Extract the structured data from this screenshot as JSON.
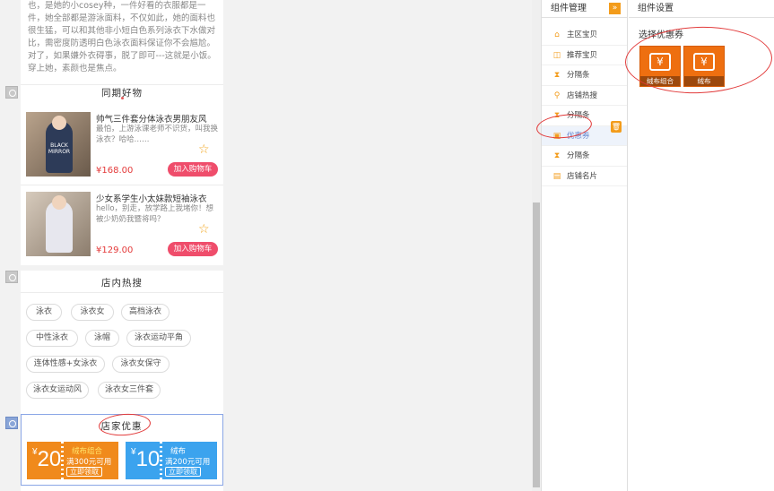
{
  "intro": {
    "text": "也，是她的小cosey种，一件好看的衣服都是一件，她全部都是游泳面料，不仅如此，她的面料也很生猛，可以和其他非小短白色系列泳衣下水做对比，需密度防透明白色泳衣面料保证你不会尴尬。对了，如果嫌外衣碍事，脱了即可---这就是小饭。穿上她，素颜也是焦点。",
    "quote": "\""
  },
  "similar": {
    "title": "同期好物",
    "products": [
      {
        "name": "帅气三件套分体泳衣男朋友风",
        "desc": "最怕，上游泳课老师不识货，叫我换泳衣？哈哈……",
        "price": "¥168.00",
        "cart": "加入购物车",
        "shirt": "BLACK MIRROR"
      },
      {
        "name": "少女系学生小太妹款短袖泳衣",
        "desc": "hello，别走，放学路上我堵你！想被少奶奶我暨将吗？",
        "price": "¥129.00",
        "cart": "加入购物车",
        "shirt": ""
      }
    ]
  },
  "hot": {
    "title": "店内热搜",
    "tags": [
      "泳衣",
      "泳衣女",
      "高档泳衣",
      "中性泳衣",
      "泳帽",
      "泳衣运动平角",
      "连体性感+女泳衣",
      "泳衣女保守",
      "泳衣女运动风",
      "泳衣女三件套"
    ]
  },
  "coupons": {
    "title": "店家优惠",
    "items": [
      {
        "currency": "¥",
        "amount": "20",
        "name": "绒布组合",
        "cond": "满300元可用",
        "btn": "立即领取",
        "color": "#f08a1c"
      },
      {
        "currency": "¥",
        "amount": "10",
        "name": "绒布",
        "cond": "满200元可用",
        "btn": "立即领取",
        "color": "#3ba3ee"
      }
    ]
  },
  "manager": {
    "title": "组件管理",
    "collapse_icon": "»",
    "items": [
      {
        "label": "主区宝贝",
        "icon": "home-icon"
      },
      {
        "label": "推荐宝贝",
        "icon": "bag-icon"
      },
      {
        "label": "分隔条",
        "icon": "divider-icon"
      },
      {
        "label": "店铺热搜",
        "icon": "search-icon"
      },
      {
        "label": "分隔条",
        "icon": "divider-icon"
      },
      {
        "label": "优惠券",
        "icon": "coupon-icon"
      },
      {
        "label": "分隔条",
        "icon": "divider-icon"
      },
      {
        "label": "店铺名片",
        "icon": "card-icon"
      }
    ]
  },
  "settings": {
    "title": "组件设置",
    "label": "选择优惠券",
    "coupons": [
      {
        "symbol": "¥",
        "caption": "绒布组合"
      },
      {
        "symbol": "¥",
        "caption": "绒布"
      }
    ]
  },
  "colors": {
    "accent": "#f39c1b",
    "price": "#e43a3a",
    "cart": "#ef4d6b",
    "selected": "#8aa6e6",
    "annotation": "#e23b3b"
  }
}
